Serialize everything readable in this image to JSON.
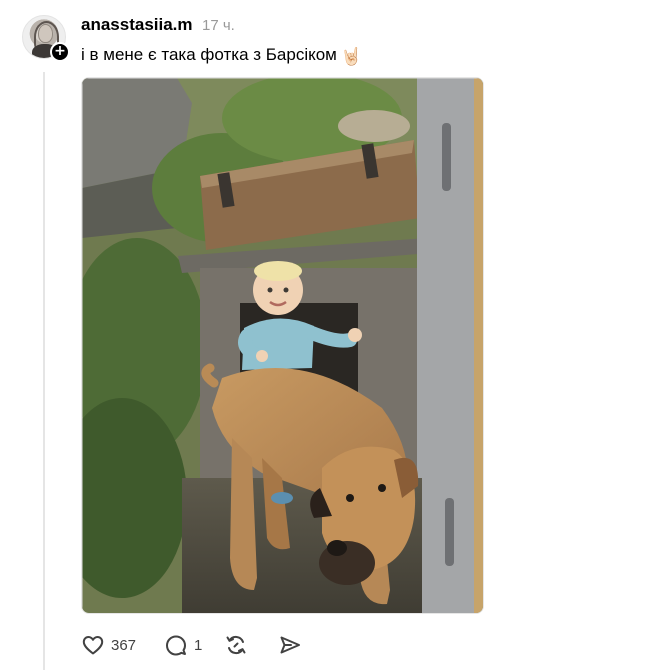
{
  "post": {
    "username": "anasstasiia.m",
    "time": "17 ч.",
    "text": "і в мене є така фотка з Барсіком",
    "text_emoji": "🤘🏻",
    "photo_alt_icon": "photo-child-with-dog",
    "follow_symbol": "+"
  },
  "actions": {
    "like": {
      "icon": "heart-icon",
      "count": "367"
    },
    "reply": {
      "icon": "comment-icon",
      "count": "1"
    },
    "repost": {
      "icon": "repost-icon"
    },
    "share": {
      "icon": "send-icon"
    }
  },
  "colors": {
    "text": "#000000",
    "muted": "#999999",
    "icon": "#424242",
    "thread_line": "#e5e5e5"
  }
}
